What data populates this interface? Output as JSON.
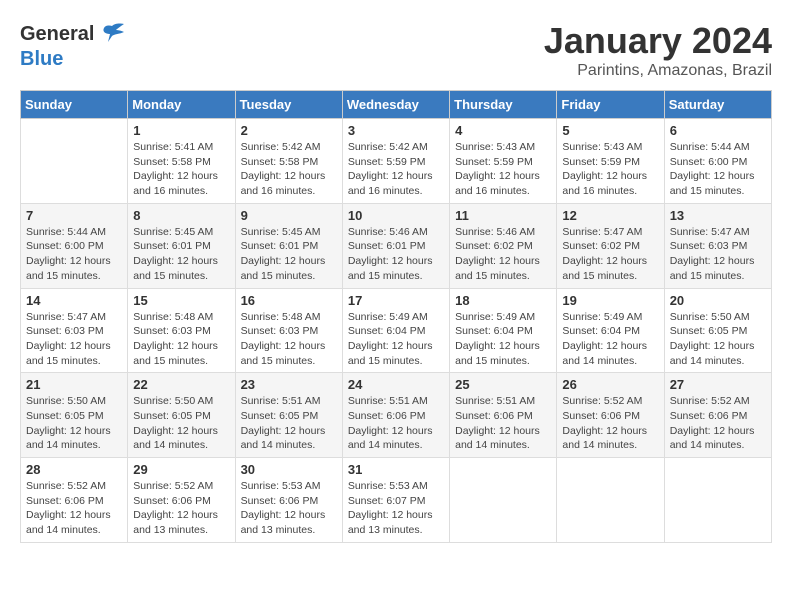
{
  "logo": {
    "text_general": "General",
    "text_blue": "Blue"
  },
  "header": {
    "month_year": "January 2024",
    "location": "Parintins, Amazonas, Brazil"
  },
  "weekdays": [
    "Sunday",
    "Monday",
    "Tuesday",
    "Wednesday",
    "Thursday",
    "Friday",
    "Saturday"
  ],
  "weeks": [
    [
      {
        "day": "",
        "sunrise": "",
        "sunset": "",
        "daylight": ""
      },
      {
        "day": "1",
        "sunrise": "Sunrise: 5:41 AM",
        "sunset": "Sunset: 5:58 PM",
        "daylight": "Daylight: 12 hours and 16 minutes."
      },
      {
        "day": "2",
        "sunrise": "Sunrise: 5:42 AM",
        "sunset": "Sunset: 5:58 PM",
        "daylight": "Daylight: 12 hours and 16 minutes."
      },
      {
        "day": "3",
        "sunrise": "Sunrise: 5:42 AM",
        "sunset": "Sunset: 5:59 PM",
        "daylight": "Daylight: 12 hours and 16 minutes."
      },
      {
        "day": "4",
        "sunrise": "Sunrise: 5:43 AM",
        "sunset": "Sunset: 5:59 PM",
        "daylight": "Daylight: 12 hours and 16 minutes."
      },
      {
        "day": "5",
        "sunrise": "Sunrise: 5:43 AM",
        "sunset": "Sunset: 5:59 PM",
        "daylight": "Daylight: 12 hours and 16 minutes."
      },
      {
        "day": "6",
        "sunrise": "Sunrise: 5:44 AM",
        "sunset": "Sunset: 6:00 PM",
        "daylight": "Daylight: 12 hours and 15 minutes."
      }
    ],
    [
      {
        "day": "7",
        "sunrise": "Sunrise: 5:44 AM",
        "sunset": "Sunset: 6:00 PM",
        "daylight": "Daylight: 12 hours and 15 minutes."
      },
      {
        "day": "8",
        "sunrise": "Sunrise: 5:45 AM",
        "sunset": "Sunset: 6:01 PM",
        "daylight": "Daylight: 12 hours and 15 minutes."
      },
      {
        "day": "9",
        "sunrise": "Sunrise: 5:45 AM",
        "sunset": "Sunset: 6:01 PM",
        "daylight": "Daylight: 12 hours and 15 minutes."
      },
      {
        "day": "10",
        "sunrise": "Sunrise: 5:46 AM",
        "sunset": "Sunset: 6:01 PM",
        "daylight": "Daylight: 12 hours and 15 minutes."
      },
      {
        "day": "11",
        "sunrise": "Sunrise: 5:46 AM",
        "sunset": "Sunset: 6:02 PM",
        "daylight": "Daylight: 12 hours and 15 minutes."
      },
      {
        "day": "12",
        "sunrise": "Sunrise: 5:47 AM",
        "sunset": "Sunset: 6:02 PM",
        "daylight": "Daylight: 12 hours and 15 minutes."
      },
      {
        "day": "13",
        "sunrise": "Sunrise: 5:47 AM",
        "sunset": "Sunset: 6:03 PM",
        "daylight": "Daylight: 12 hours and 15 minutes."
      }
    ],
    [
      {
        "day": "14",
        "sunrise": "Sunrise: 5:47 AM",
        "sunset": "Sunset: 6:03 PM",
        "daylight": "Daylight: 12 hours and 15 minutes."
      },
      {
        "day": "15",
        "sunrise": "Sunrise: 5:48 AM",
        "sunset": "Sunset: 6:03 PM",
        "daylight": "Daylight: 12 hours and 15 minutes."
      },
      {
        "day": "16",
        "sunrise": "Sunrise: 5:48 AM",
        "sunset": "Sunset: 6:03 PM",
        "daylight": "Daylight: 12 hours and 15 minutes."
      },
      {
        "day": "17",
        "sunrise": "Sunrise: 5:49 AM",
        "sunset": "Sunset: 6:04 PM",
        "daylight": "Daylight: 12 hours and 15 minutes."
      },
      {
        "day": "18",
        "sunrise": "Sunrise: 5:49 AM",
        "sunset": "Sunset: 6:04 PM",
        "daylight": "Daylight: 12 hours and 15 minutes."
      },
      {
        "day": "19",
        "sunrise": "Sunrise: 5:49 AM",
        "sunset": "Sunset: 6:04 PM",
        "daylight": "Daylight: 12 hours and 14 minutes."
      },
      {
        "day": "20",
        "sunrise": "Sunrise: 5:50 AM",
        "sunset": "Sunset: 6:05 PM",
        "daylight": "Daylight: 12 hours and 14 minutes."
      }
    ],
    [
      {
        "day": "21",
        "sunrise": "Sunrise: 5:50 AM",
        "sunset": "Sunset: 6:05 PM",
        "daylight": "Daylight: 12 hours and 14 minutes."
      },
      {
        "day": "22",
        "sunrise": "Sunrise: 5:50 AM",
        "sunset": "Sunset: 6:05 PM",
        "daylight": "Daylight: 12 hours and 14 minutes."
      },
      {
        "day": "23",
        "sunrise": "Sunrise: 5:51 AM",
        "sunset": "Sunset: 6:05 PM",
        "daylight": "Daylight: 12 hours and 14 minutes."
      },
      {
        "day": "24",
        "sunrise": "Sunrise: 5:51 AM",
        "sunset": "Sunset: 6:06 PM",
        "daylight": "Daylight: 12 hours and 14 minutes."
      },
      {
        "day": "25",
        "sunrise": "Sunrise: 5:51 AM",
        "sunset": "Sunset: 6:06 PM",
        "daylight": "Daylight: 12 hours and 14 minutes."
      },
      {
        "day": "26",
        "sunrise": "Sunrise: 5:52 AM",
        "sunset": "Sunset: 6:06 PM",
        "daylight": "Daylight: 12 hours and 14 minutes."
      },
      {
        "day": "27",
        "sunrise": "Sunrise: 5:52 AM",
        "sunset": "Sunset: 6:06 PM",
        "daylight": "Daylight: 12 hours and 14 minutes."
      }
    ],
    [
      {
        "day": "28",
        "sunrise": "Sunrise: 5:52 AM",
        "sunset": "Sunset: 6:06 PM",
        "daylight": "Daylight: 12 hours and 14 minutes."
      },
      {
        "day": "29",
        "sunrise": "Sunrise: 5:52 AM",
        "sunset": "Sunset: 6:06 PM",
        "daylight": "Daylight: 12 hours and 13 minutes."
      },
      {
        "day": "30",
        "sunrise": "Sunrise: 5:53 AM",
        "sunset": "Sunset: 6:06 PM",
        "daylight": "Daylight: 12 hours and 13 minutes."
      },
      {
        "day": "31",
        "sunrise": "Sunrise: 5:53 AM",
        "sunset": "Sunset: 6:07 PM",
        "daylight": "Daylight: 12 hours and 13 minutes."
      },
      {
        "day": "",
        "sunrise": "",
        "sunset": "",
        "daylight": ""
      },
      {
        "day": "",
        "sunrise": "",
        "sunset": "",
        "daylight": ""
      },
      {
        "day": "",
        "sunrise": "",
        "sunset": "",
        "daylight": ""
      }
    ]
  ]
}
